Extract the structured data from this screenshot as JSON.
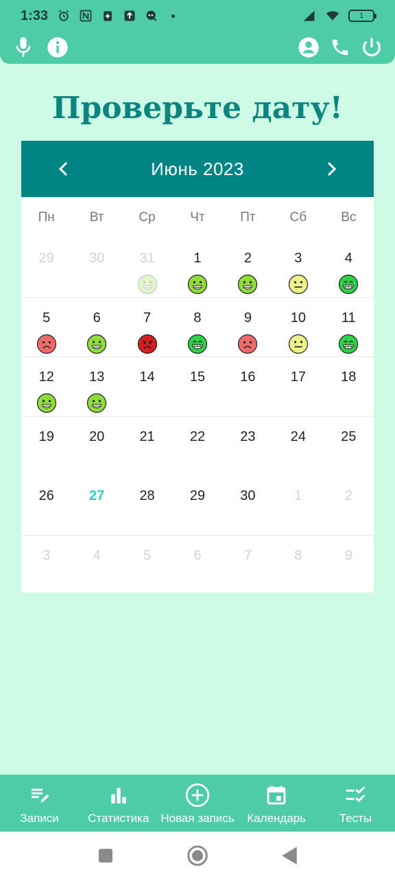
{
  "status_bar": {
    "time": "1:33",
    "battery": "1",
    "icons": [
      "alarm-icon",
      "nfc-icon",
      "medical-icon",
      "upload-icon",
      "chat-icon"
    ]
  },
  "app_bar": {
    "left_icons": [
      "microphone-icon",
      "info-icon"
    ],
    "right_icons": [
      "account-icon",
      "phone-icon",
      "power-icon"
    ]
  },
  "page": {
    "title": "Проверьте дату!"
  },
  "calendar": {
    "month_label": "Июнь  2023",
    "weekdays": [
      "Пн",
      "Вт",
      "Ср",
      "Чт",
      "Пт",
      "Сб",
      "Вс"
    ],
    "weeks": [
      [
        {
          "num": "29",
          "muted": true,
          "mood": null
        },
        {
          "num": "30",
          "muted": true,
          "mood": null
        },
        {
          "num": "31",
          "muted": true,
          "mood": "happy"
        },
        {
          "num": "1",
          "muted": false,
          "mood": "happy"
        },
        {
          "num": "2",
          "muted": false,
          "mood": "happy"
        },
        {
          "num": "3",
          "muted": false,
          "mood": "neutral"
        },
        {
          "num": "4",
          "muted": false,
          "mood": "ecstatic"
        }
      ],
      [
        {
          "num": "5",
          "muted": false,
          "mood": "sad"
        },
        {
          "num": "6",
          "muted": false,
          "mood": "happy"
        },
        {
          "num": "7",
          "muted": false,
          "mood": "angry"
        },
        {
          "num": "8",
          "muted": false,
          "mood": "ecstatic"
        },
        {
          "num": "9",
          "muted": false,
          "mood": "sad"
        },
        {
          "num": "10",
          "muted": false,
          "mood": "neutral"
        },
        {
          "num": "11",
          "muted": false,
          "mood": "ecstatic"
        }
      ],
      [
        {
          "num": "12",
          "muted": false,
          "mood": "happy"
        },
        {
          "num": "13",
          "muted": false,
          "mood": "happy"
        },
        {
          "num": "14",
          "muted": false,
          "mood": null
        },
        {
          "num": "15",
          "muted": false,
          "mood": null
        },
        {
          "num": "16",
          "muted": false,
          "mood": null
        },
        {
          "num": "17",
          "muted": false,
          "mood": null
        },
        {
          "num": "18",
          "muted": false,
          "mood": null
        }
      ],
      [
        {
          "num": "19",
          "muted": false,
          "mood": null
        },
        {
          "num": "20",
          "muted": false,
          "mood": null
        },
        {
          "num": "21",
          "muted": false,
          "mood": null
        },
        {
          "num": "22",
          "muted": false,
          "mood": null
        },
        {
          "num": "23",
          "muted": false,
          "mood": null
        },
        {
          "num": "24",
          "muted": false,
          "mood": null
        },
        {
          "num": "25",
          "muted": false,
          "mood": null
        }
      ],
      [
        {
          "num": "26",
          "muted": false,
          "mood": null
        },
        {
          "num": "27",
          "muted": false,
          "mood": null,
          "today": true
        },
        {
          "num": "28",
          "muted": false,
          "mood": null
        },
        {
          "num": "29",
          "muted": false,
          "mood": null
        },
        {
          "num": "30",
          "muted": false,
          "mood": null
        },
        {
          "num": "1",
          "muted": true,
          "mood": null
        },
        {
          "num": "2",
          "muted": true,
          "mood": null
        }
      ],
      [
        {
          "num": "3",
          "muted": true,
          "mood": null
        },
        {
          "num": "4",
          "muted": true,
          "mood": null
        },
        {
          "num": "5",
          "muted": true,
          "mood": null
        },
        {
          "num": "6",
          "muted": true,
          "mood": null
        },
        {
          "num": "7",
          "muted": true,
          "mood": null
        },
        {
          "num": "8",
          "muted": true,
          "mood": null
        },
        {
          "num": "9",
          "muted": true,
          "mood": null
        }
      ]
    ]
  },
  "mood_colors": {
    "happy": "#8fdc3a",
    "ecstatic": "#2ed24a",
    "neutral": "#eef08a",
    "sad": "#ee6a6a",
    "angry": "#d42020"
  },
  "bottom_nav": [
    {
      "label": "Записи",
      "icon": "notes-edit-icon"
    },
    {
      "label": "Статистика",
      "icon": "bar-chart-icon"
    },
    {
      "label": "Новая запись",
      "icon": "add-circle-icon"
    },
    {
      "label": "Календарь",
      "icon": "calendar-icon"
    },
    {
      "label": "Тесты",
      "icon": "checklist-icon"
    }
  ],
  "colors": {
    "background": "#cdfbe6",
    "bar": "#4ecca6",
    "calendar_header": "#008584",
    "title": "#0c8580",
    "today": "#2ad4c4"
  }
}
